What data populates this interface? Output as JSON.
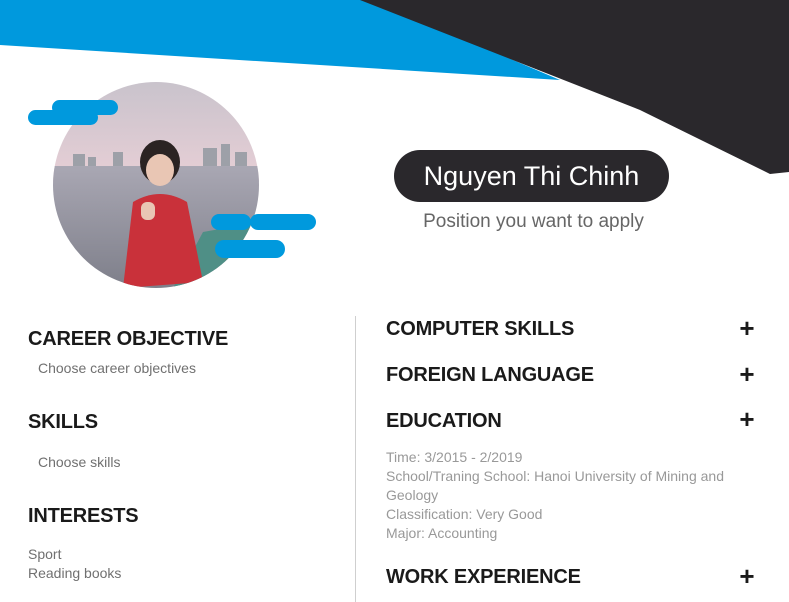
{
  "header": {
    "name": "Nguyen Thi Chinh",
    "position_placeholder": "Position you want to apply"
  },
  "colors": {
    "accent": "#0099dd",
    "dark": "#2a282c",
    "background": "#ffffff"
  },
  "left": {
    "career_objective": {
      "title": "CAREER OBJECTIVE",
      "placeholder": "Choose career objectives"
    },
    "skills": {
      "title": "SKILLS",
      "placeholder": "Choose skills"
    },
    "interests": {
      "title": "INTERESTS",
      "items": [
        "Sport",
        "Reading books"
      ]
    }
  },
  "right": {
    "computer_skills": {
      "title": "COMPUTER SKILLS",
      "action": "+"
    },
    "foreign_language": {
      "title": "FOREIGN LANGUAGE",
      "action": "+"
    },
    "education": {
      "title": "EDUCATION",
      "action": "+",
      "lines": [
        "Time: 3/2015 - 2/2019",
        "School/Traning School: Hanoi University of Mining and",
        "Geology",
        "Classification: Very Good",
        "Major: Accounting"
      ]
    },
    "work_experience": {
      "title": "WORK EXPERIENCE",
      "action": "+"
    }
  }
}
